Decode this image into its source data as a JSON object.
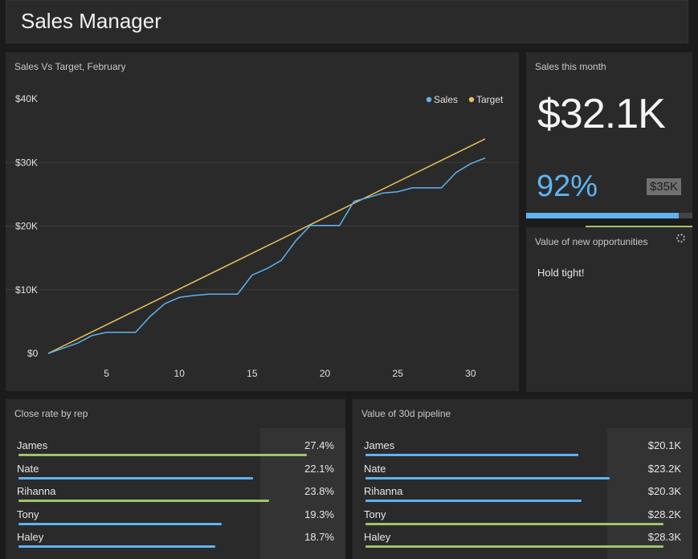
{
  "header": {
    "title": "Sales Manager"
  },
  "chart_panel": {
    "title": "Sales Vs Target, February",
    "chart_data": {
      "type": "line",
      "x_ticks": [
        5,
        10,
        15,
        20,
        25,
        30
      ],
      "y_ticks": [
        0,
        10000,
        20000,
        30000,
        40000
      ],
      "y_tick_labels": [
        "$0",
        "$10K",
        "$20K",
        "$30K",
        "$40K"
      ],
      "xlim": [
        1,
        31
      ],
      "ylim": [
        0,
        40000
      ],
      "legend_position": "top-right",
      "grid": true,
      "series": [
        {
          "name": "Sales",
          "color": "#5fb3f1",
          "x": [
            1,
            2,
            3,
            4,
            5,
            6,
            7,
            8,
            9,
            10,
            11,
            12,
            13,
            14,
            15,
            16,
            17,
            18,
            19,
            20,
            21,
            22,
            23,
            24,
            25,
            26,
            27,
            28,
            29,
            30,
            31
          ],
          "values": [
            0,
            800,
            1600,
            2800,
            3300,
            3300,
            3300,
            5800,
            7800,
            8800,
            9100,
            9300,
            9300,
            9300,
            12300,
            13300,
            14600,
            17700,
            20100,
            20100,
            20100,
            23900,
            24500,
            25200,
            25400,
            26000,
            26000,
            26000,
            28400,
            29800,
            30700
          ]
        },
        {
          "name": "Target",
          "color": "#e6c25a",
          "x": [
            1,
            31
          ],
          "values": [
            0,
            33700
          ]
        }
      ]
    }
  },
  "kpi": {
    "title": "Sales this month",
    "value": "$32.1K",
    "percent": "92%",
    "target": "$35K",
    "progress": 0.92,
    "accent": "#5fb3f1"
  },
  "opportunities": {
    "title": "Value of new opportunities",
    "message": "Hold tight!"
  },
  "close_rate": {
    "title": "Close rate by rep",
    "rows": [
      {
        "name": "James",
        "value": "27.4%",
        "fraction": 0.91,
        "color": "#9fc46a"
      },
      {
        "name": "Nate",
        "value": "22.1%",
        "fraction": 0.74,
        "color": "#5fb3f1"
      },
      {
        "name": "Rihanna",
        "value": "23.8%",
        "fraction": 0.79,
        "color": "#9fc46a"
      },
      {
        "name": "Tony",
        "value": "19.3%",
        "fraction": 0.64,
        "color": "#5fb3f1"
      },
      {
        "name": "Haley",
        "value": "18.7%",
        "fraction": 0.62,
        "color": "#5fb3f1"
      }
    ]
  },
  "pipeline": {
    "title": "Value of 30d pipeline",
    "rows": [
      {
        "name": "James",
        "value": "$20.1K",
        "fraction": 0.67,
        "color": "#5fb3f1"
      },
      {
        "name": "Nate",
        "value": "$23.2K",
        "fraction": 0.77,
        "color": "#5fb3f1"
      },
      {
        "name": "Rihanna",
        "value": "$20.3K",
        "fraction": 0.68,
        "color": "#5fb3f1"
      },
      {
        "name": "Tony",
        "value": "$28.2K",
        "fraction": 0.94,
        "color": "#9fc46a"
      },
      {
        "name": "Haley",
        "value": "$28.3K",
        "fraction": 0.94,
        "color": "#9fc46a"
      }
    ]
  }
}
